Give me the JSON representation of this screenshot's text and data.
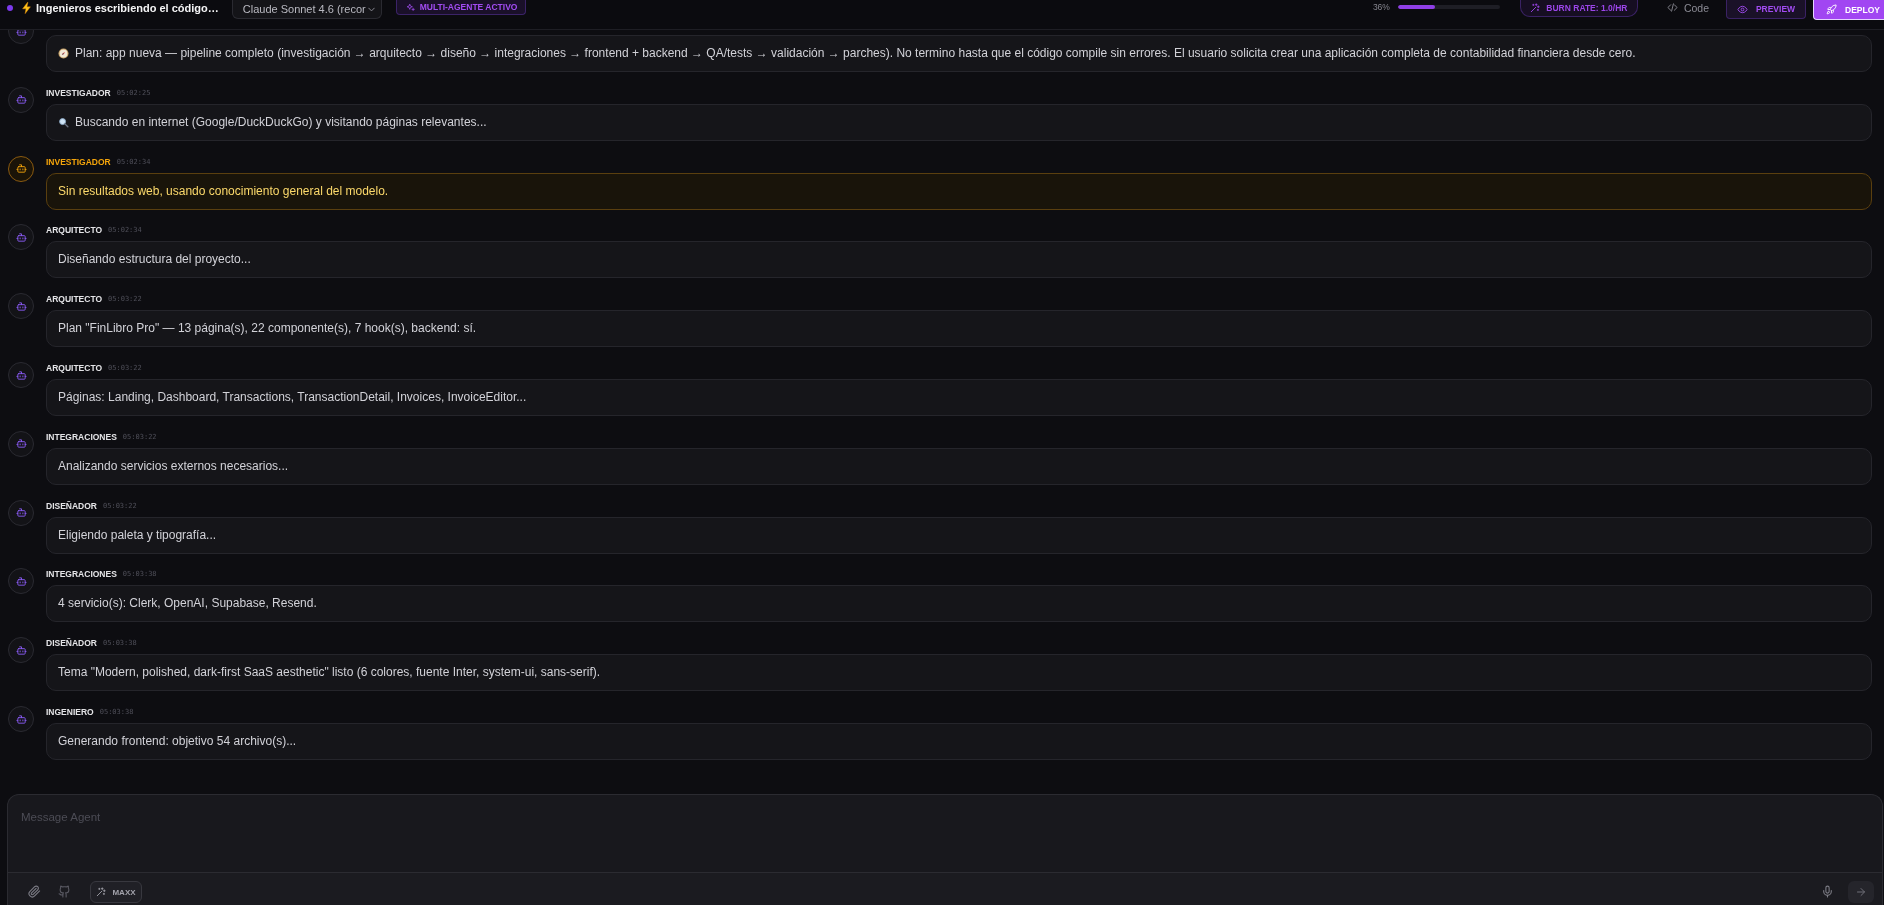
{
  "header": {
    "title": "Ingenieros escribiendo el código…",
    "model": "Claude Sonnet 4.6 (recor",
    "mode_badge": "MULTI-AGENTE ACTIVO",
    "progress": {
      "reading": "36%",
      "level": 0.36
    },
    "burn_rate": "BURN RATE: 1.0/HR",
    "actions": [
      {
        "kind": "code",
        "label": "Code"
      },
      {
        "kind": "preview",
        "label": "PREVIEW"
      },
      {
        "kind": "deploy",
        "label": "DEPLOY"
      }
    ]
  },
  "messages": [
    {
      "kind": "plan",
      "text": "Plan: app nueva — pipeline completo (investigación → arquitecto → diseño → integraciones → frontend + backend → QA/tests → validación → parches). No termino hasta que el código compile sin errores. El usuario solicita crear una aplicación completa de contabilidad financiera desde cero."
    },
    {
      "agent": "INVESTIGADOR",
      "time": "05:02:25",
      "kind": "search",
      "text": "Buscando en internet (Google/DuckDuckGo) y visitando páginas relevantes..."
    },
    {
      "agent": "INVESTIGADOR",
      "time": "05:02:34",
      "kind": "warning",
      "text": "Sin resultados web, usando conocimiento general del modelo."
    },
    {
      "agent": "ARQUITECTO",
      "time": "05:02:34",
      "kind": "info",
      "text": "Diseñando estructura del proyecto..."
    },
    {
      "agent": "ARQUITECTO",
      "time": "05:03:22",
      "kind": "info",
      "text": "Plan \"FinLibro Pro\" — 13 página(s), 22 componente(s), 7 hook(s), backend: sí."
    },
    {
      "agent": "ARQUITECTO",
      "time": "05:03:22",
      "kind": "info",
      "text": "Páginas: Landing, Dashboard, Transactions, TransactionDetail, Invoices, InvoiceEditor..."
    },
    {
      "agent": "INTEGRACIONES",
      "time": "05:03:22",
      "kind": "info",
      "text": "Analizando servicios externos necesarios..."
    },
    {
      "agent": "DISEÑADOR",
      "time": "05:03:22",
      "kind": "info",
      "text": "Eligiendo paleta y tipografía..."
    },
    {
      "agent": "INTEGRACIONES",
      "time": "05:03:38",
      "kind": "info",
      "text": "4 servicio(s): Clerk, OpenAI, Supabase, Resend."
    },
    {
      "agent": "DISEÑADOR",
      "time": "05:03:38",
      "kind": "info",
      "text": "Tema \"Modern, polished, dark-first SaaS aesthetic\" listo (6 colores, fuente Inter, system-ui, sans-serif)."
    },
    {
      "agent": "INGENIERO",
      "time": "05:03:38",
      "kind": "info",
      "text": "Generando frontend: objetivo 54 archivo(s)..."
    }
  ],
  "composer": {
    "placeholder": "Message Agent",
    "mode_button": "MAXX"
  }
}
